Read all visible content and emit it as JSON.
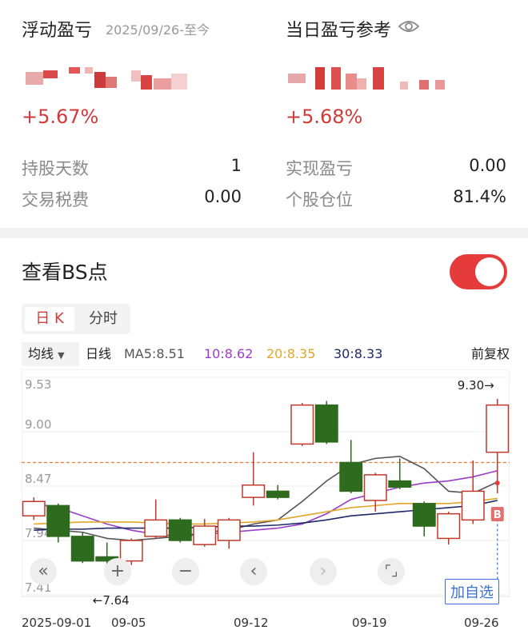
{
  "summary": {
    "floating_label": "浮动盈亏",
    "floating_date": "2025/09/26-至今",
    "floating_pct": "+5.67%",
    "daily_label": "当日盈亏参考",
    "daily_pct": "+5.68%",
    "stats": [
      {
        "label": "持股天数",
        "value": "1"
      },
      {
        "label": "交易税费",
        "value": "0.00"
      },
      {
        "label": "实现盈亏",
        "value": "0.00"
      },
      {
        "label": "个股仓位",
        "value": "81.4%"
      }
    ]
  },
  "bs_section": {
    "title": "查看BS点",
    "toggle_on": true,
    "tabs": [
      "日 K",
      "分时"
    ],
    "ma_button": "均线",
    "ma_items": [
      {
        "text": "日线",
        "color": "#222222"
      },
      {
        "text": "MA5:8.51",
        "color": "#555555"
      },
      {
        "text": "10:8.62",
        "color": "#9b3cc7"
      },
      {
        "text": "20:8.35",
        "color": "#e0a72a"
      },
      {
        "text": "30:8.33",
        "color": "#1f2a6b"
      }
    ],
    "adjust": "前复权",
    "add_watch": "加自选"
  },
  "chart_data": {
    "type": "candlestick",
    "y_ticks": [
      "9.53",
      "9.00",
      "8.47",
      "7.94",
      "7.41"
    ],
    "ylim": [
      7.41,
      9.53
    ],
    "x_labels": [
      "2025-09-01",
      "09-05",
      "09-12",
      "09-19",
      "09-26"
    ],
    "high_label": "9.30→",
    "low_label": "←7.64",
    "ref_line": 8.7,
    "marker": "B",
    "candles": [
      {
        "o": 8.18,
        "c": 8.32,
        "h": 8.36,
        "l": 8.14
      },
      {
        "o": 8.28,
        "c": 7.98,
        "h": 8.3,
        "l": 7.92
      },
      {
        "o": 7.98,
        "c": 7.74,
        "h": 8.02,
        "l": 7.72
      },
      {
        "o": 7.78,
        "c": 7.74,
        "h": 7.92,
        "l": 7.64
      },
      {
        "o": 7.74,
        "c": 7.94,
        "h": 7.96,
        "l": 7.7
      },
      {
        "o": 7.98,
        "c": 8.14,
        "h": 8.34,
        "l": 7.96
      },
      {
        "o": 8.14,
        "c": 7.94,
        "h": 8.16,
        "l": 7.92
      },
      {
        "o": 7.9,
        "c": 8.08,
        "h": 8.15,
        "l": 7.88
      },
      {
        "o": 7.94,
        "c": 8.14,
        "h": 8.16,
        "l": 7.86
      },
      {
        "o": 8.36,
        "c": 8.48,
        "h": 8.8,
        "l": 8.28
      },
      {
        "o": 8.42,
        "c": 8.36,
        "h": 8.48,
        "l": 8.34
      },
      {
        "o": 8.88,
        "c": 9.26,
        "h": 9.28,
        "l": 8.86
      },
      {
        "o": 9.26,
        "c": 8.9,
        "h": 9.3,
        "l": 8.88
      },
      {
        "o": 8.7,
        "c": 8.42,
        "h": 8.92,
        "l": 8.4
      },
      {
        "o": 8.33,
        "c": 8.58,
        "h": 8.6,
        "l": 8.22
      },
      {
        "o": 8.52,
        "c": 8.46,
        "h": 8.74,
        "l": 8.44
      },
      {
        "o": 8.3,
        "c": 8.08,
        "h": 8.32,
        "l": 7.98
      },
      {
        "o": 7.96,
        "c": 8.2,
        "h": 8.22,
        "l": 7.9
      },
      {
        "o": 8.14,
        "c": 8.42,
        "h": 8.72,
        "l": 8.1
      },
      {
        "o": 8.8,
        "c": 9.26,
        "h": 9.32,
        "l": 8.4
      }
    ],
    "series": [
      {
        "color": "#555555",
        "values": [
          8.06,
          8.04,
          8.02,
          7.96,
          7.94,
          7.96,
          7.98,
          8.02,
          8.04,
          8.1,
          8.14,
          8.32,
          8.52,
          8.68,
          8.74,
          8.76,
          8.64,
          8.42,
          8.4,
          8.51
        ]
      },
      {
        "color": "#9b3cc7",
        "values": [
          8.3,
          8.26,
          8.18,
          8.1,
          8.04,
          8.0,
          7.98,
          8.0,
          8.02,
          8.04,
          8.06,
          8.1,
          8.2,
          8.34,
          8.4,
          8.46,
          8.5,
          8.52,
          8.56,
          8.62
        ]
      },
      {
        "color": "#e0a72a",
        "values": [
          8.1,
          8.11,
          8.12,
          8.12,
          8.12,
          8.11,
          8.1,
          8.1,
          8.11,
          8.12,
          8.14,
          8.18,
          8.22,
          8.26,
          8.28,
          8.3,
          8.3,
          8.3,
          8.32,
          8.35
        ]
      },
      {
        "color": "#1f2a6b",
        "values": [
          8.04,
          8.05,
          8.05,
          8.06,
          8.06,
          8.06,
          8.06,
          8.07,
          8.08,
          8.08,
          8.09,
          8.11,
          8.14,
          8.18,
          8.2,
          8.22,
          8.24,
          8.26,
          8.28,
          8.33
        ]
      }
    ]
  },
  "colors": {
    "up": "#c0392b",
    "down": "#2e6b1e",
    "accent": "#e63b3b"
  },
  "controls": [
    "double-chevron-left-icon",
    "plus-icon",
    "minus-icon",
    "chevron-left-icon",
    "chevron-right-icon",
    "fullscreen-icon"
  ]
}
